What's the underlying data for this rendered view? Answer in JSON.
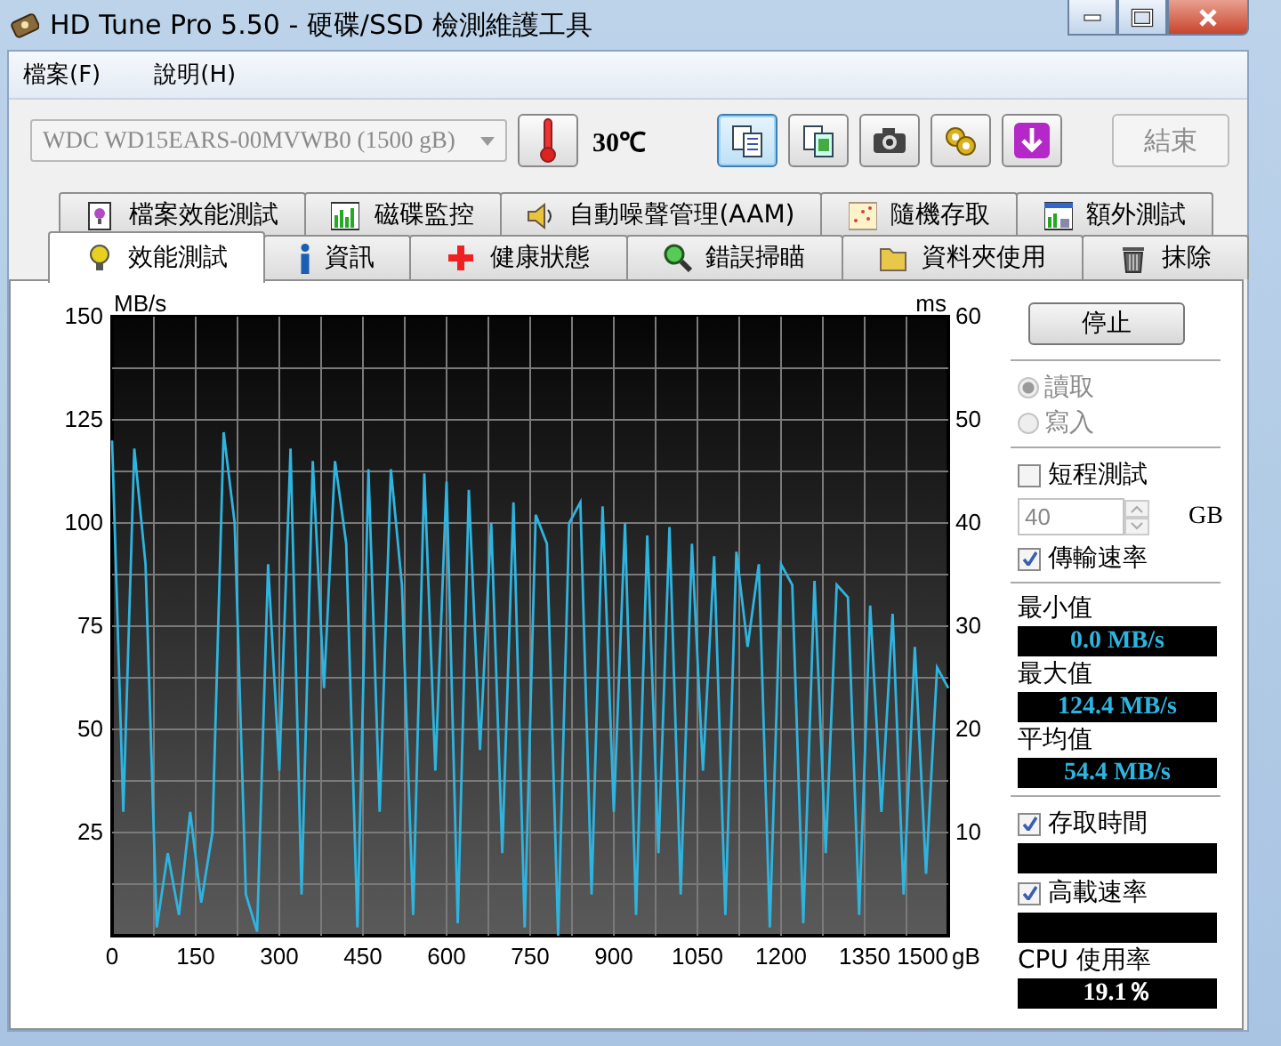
{
  "window": {
    "title": "HD Tune Pro 5.50 - 硬碟/SSD 檢測維護工具"
  },
  "menu": [
    {
      "label": "檔案(F)"
    },
    {
      "label": "說明(H)"
    }
  ],
  "toolbar": {
    "drive": {
      "value": "WDC WD15EARS-00MVWB0 (1500 gB)",
      "disabled": true
    },
    "temperature": "30℃",
    "tool_buttons": [
      {
        "kind": "copy-text",
        "selected": true
      },
      {
        "kind": "copy-image",
        "selected": false
      },
      {
        "kind": "camera",
        "selected": false
      },
      {
        "kind": "settings",
        "selected": false
      },
      {
        "kind": "download",
        "selected": false
      }
    ],
    "exit_button": {
      "label": "結束",
      "disabled": true
    }
  },
  "tab_rows": [
    [
      {
        "label": "檔案效能測試",
        "kind": "file",
        "selected": false
      },
      {
        "label": "磁碟監控",
        "kind": "monitor",
        "selected": false
      },
      {
        "label": "自動噪聲管理(AAM)",
        "kind": "speaker",
        "selected": false
      },
      {
        "label": "隨機存取",
        "kind": "scatter",
        "selected": false
      },
      {
        "label": "額外測試",
        "kind": "extra",
        "selected": false
      }
    ],
    [
      {
        "label": "效能測試",
        "kind": "bulb",
        "selected": true
      },
      {
        "label": "資訊",
        "kind": "info",
        "selected": false
      },
      {
        "label": "健康狀態",
        "kind": "cross",
        "selected": false
      },
      {
        "label": "錯誤掃瞄",
        "kind": "magnifier",
        "selected": false
      },
      {
        "label": "資料夾使用",
        "kind": "folder",
        "selected": false
      },
      {
        "label": "抹除",
        "kind": "trash",
        "selected": false
      }
    ]
  ],
  "chart_data": {
    "type": "line",
    "xlabel": "gB",
    "ylabel": "MB/s",
    "y2label": "ms",
    "xlim": [
      0,
      1500
    ],
    "ylim": [
      0,
      150
    ],
    "y2lim": [
      0,
      60
    ],
    "xticks": [
      0,
      150,
      300,
      450,
      600,
      750,
      900,
      1050,
      1200,
      1350,
      1500
    ],
    "yticks": [
      25,
      50,
      75,
      100,
      125,
      150
    ],
    "y2ticks": [
      10,
      20,
      30,
      40,
      50,
      60
    ],
    "x": [
      0,
      20,
      40,
      60,
      80,
      100,
      120,
      140,
      160,
      180,
      200,
      220,
      240,
      260,
      280,
      300,
      320,
      340,
      360,
      380,
      400,
      420,
      440,
      460,
      480,
      500,
      520,
      540,
      560,
      580,
      600,
      620,
      640,
      660,
      680,
      700,
      720,
      740,
      760,
      780,
      800,
      820,
      840,
      860,
      880,
      900,
      920,
      940,
      960,
      980,
      1000,
      1020,
      1040,
      1060,
      1080,
      1100,
      1120,
      1140,
      1160,
      1180,
      1200,
      1220,
      1240,
      1260,
      1280,
      1300,
      1320,
      1340,
      1360,
      1380,
      1400,
      1420,
      1440,
      1460,
      1480,
      1500
    ],
    "grid": true,
    "series": [
      {
        "color": "#2fb4e0",
        "values": [
          120,
          30,
          118,
          90,
          2,
          20,
          5,
          30,
          8,
          25,
          122,
          100,
          10,
          1,
          90,
          40,
          118,
          10,
          115,
          60,
          115,
          95,
          2,
          113,
          30,
          113,
          85,
          5,
          112,
          40,
          110,
          3,
          108,
          45,
          100,
          20,
          105,
          2,
          102,
          95,
          0,
          100,
          105,
          10,
          104,
          30,
          100,
          5,
          97,
          20,
          99,
          10,
          95,
          40,
          92,
          5,
          93,
          70,
          90,
          2,
          90,
          85,
          3,
          86,
          20,
          85,
          82,
          5,
          80,
          30,
          78,
          10,
          70,
          15,
          65,
          60
        ]
      }
    ]
  },
  "side": {
    "stop_button": "停止",
    "modes": [
      {
        "label": "讀取",
        "selected": true,
        "disabled": true
      },
      {
        "label": "寫入",
        "selected": false,
        "disabled": true
      }
    ],
    "short_test": {
      "label": "短程測試",
      "checked": false
    },
    "size": {
      "value": "40",
      "disabled": true,
      "unit": "GB"
    },
    "transfer_rate": {
      "label": "傳輸速率",
      "checked": true
    },
    "stats": [
      {
        "label": "最小值",
        "value": "0.0 MB/s"
      },
      {
        "label": "最大值",
        "value": "124.4 MB/s"
      },
      {
        "label": "平均值",
        "value": "54.4 MB/s"
      }
    ],
    "access_time": {
      "label": "存取時間",
      "checked": true
    },
    "burst_rate": {
      "label": "高載速率",
      "checked": true
    },
    "cpu": {
      "label": "CPU 使用率",
      "value": "19.1％"
    }
  }
}
